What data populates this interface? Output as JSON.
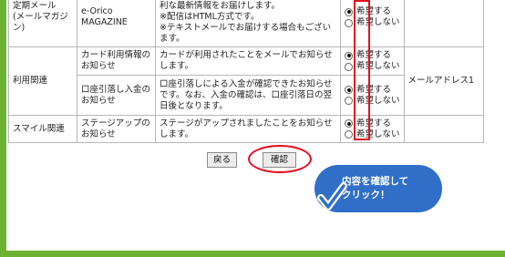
{
  "table": {
    "rows": [
      {
        "category": "定期メール\n(メールマガジン)",
        "item": "e-Orico MAGAZINE",
        "description": "各種キャンペーンやサービスなど、お得で便利な最新情報をお届けします。\n※配信はHTML方式です。\n※テキストメールでお届けする場合もございます。",
        "options": [
          "希望する",
          "希望しない"
        ],
        "selected": 0
      },
      {
        "category": "利用関連",
        "item": "カード利用情報のお知らせ",
        "description": "カードが利用されたことをメールでお知らせします。",
        "options": [
          "希望する",
          "希望しない"
        ],
        "selected": 0
      },
      {
        "item": "口座引落し入金のお知らせ",
        "description": "口座引落しによる入金が確認できたお知らせです。なお、入金の確認は、口座引落日の翌日後となります。",
        "options": [
          "希望する",
          "希望しない"
        ],
        "selected": 0
      },
      {
        "category": "スマイル関連",
        "item": "ステージアップのお知らせ",
        "description": "ステージがアップされましたことをお知らせします。",
        "options": [
          "希望する",
          "希望しない"
        ],
        "selected": 0
      }
    ],
    "address_label": "メールアドレス1"
  },
  "buttons": {
    "back": "戻る",
    "confirm": "確認"
  },
  "callout": {
    "text": "内容を確認して\nクリック！"
  },
  "colors": {
    "highlight": "#e4101d",
    "callout": "#2f6fc8",
    "frame": "#6fb232"
  },
  "icons": {
    "callout_icon": "checkmark-icon"
  }
}
